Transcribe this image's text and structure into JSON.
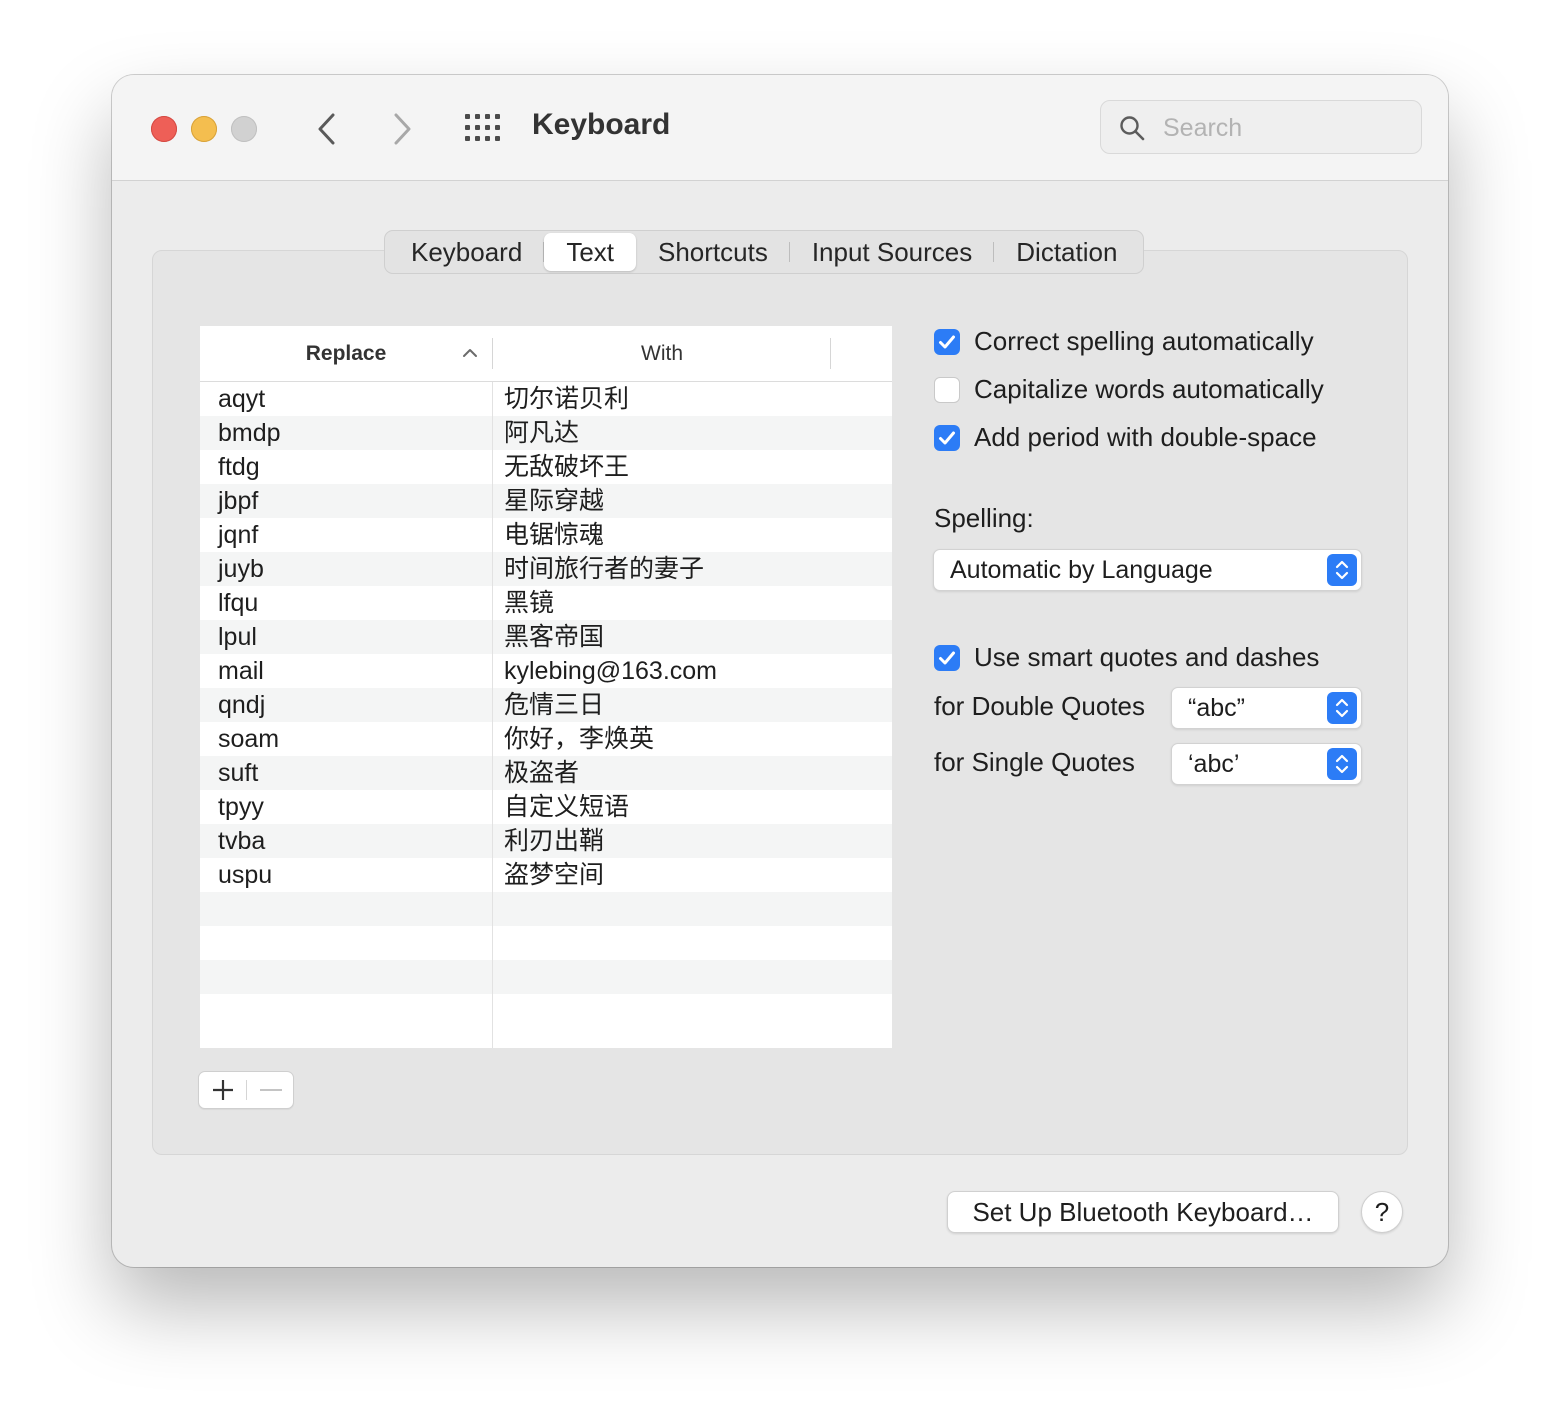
{
  "window": {
    "title": "Keyboard"
  },
  "search": {
    "placeholder": "Search"
  },
  "tabs": [
    {
      "label": "Keyboard",
      "active": false
    },
    {
      "label": "Text",
      "active": true
    },
    {
      "label": "Shortcuts",
      "active": false
    },
    {
      "label": "Input Sources",
      "active": false
    },
    {
      "label": "Dictation",
      "active": false
    }
  ],
  "table": {
    "columns": {
      "replace": "Replace",
      "with": "With",
      "sort": "ascending"
    },
    "rows": [
      {
        "replace": "aqyt",
        "with": "切尔诺贝利"
      },
      {
        "replace": "bmdp",
        "with": "阿凡达"
      },
      {
        "replace": "ftdg",
        "with": "无敌破坏王"
      },
      {
        "replace": "jbpf",
        "with": "星际穿越"
      },
      {
        "replace": "jqnf",
        "with": "电锯惊魂"
      },
      {
        "replace": "juyb",
        "with": "时间旅行者的妻子"
      },
      {
        "replace": "lfqu",
        "with": "黑镜"
      },
      {
        "replace": "lpul",
        "with": "黑客帝国"
      },
      {
        "replace": "mail",
        "with": "kylebing@163.com"
      },
      {
        "replace": "qndj",
        "with": "危情三日"
      },
      {
        "replace": "soam",
        "with": "你好，李焕英"
      },
      {
        "replace": "suft",
        "with": "极盗者"
      },
      {
        "replace": "tpyy",
        "with": "自定义短语"
      },
      {
        "replace": "tvba",
        "with": "利刃出鞘"
      },
      {
        "replace": "uspu",
        "with": "盗梦空间"
      }
    ]
  },
  "options": {
    "correct_spelling": {
      "label": "Correct spelling automatically",
      "checked": true
    },
    "capitalize_words": {
      "label": "Capitalize words automatically",
      "checked": false
    },
    "add_period": {
      "label": "Add period with double-space",
      "checked": true
    },
    "spelling_label": "Spelling:",
    "spelling_value": "Automatic by Language",
    "smart_quotes": {
      "label": "Use smart quotes and dashes",
      "checked": true
    },
    "double_quotes_label": "for Double Quotes",
    "double_quotes_value": "“abc”",
    "single_quotes_label": "for Single Quotes",
    "single_quotes_value": "‘abc’"
  },
  "footer": {
    "bluetooth_button": "Set Up Bluetooth Keyboard…",
    "help_button": "?"
  },
  "colors": {
    "accent": "#2c7cf6",
    "close": "#ee5f57",
    "minimize": "#f4be4f"
  },
  "icons": [
    "close-icon",
    "minimize-icon",
    "zoom-icon",
    "chevron-left-icon",
    "chevron-right-icon",
    "grid-icon",
    "search-icon",
    "sort-ascending-icon",
    "plus-icon",
    "minus-icon",
    "checkmark-icon",
    "updown-chevron-icon"
  ]
}
